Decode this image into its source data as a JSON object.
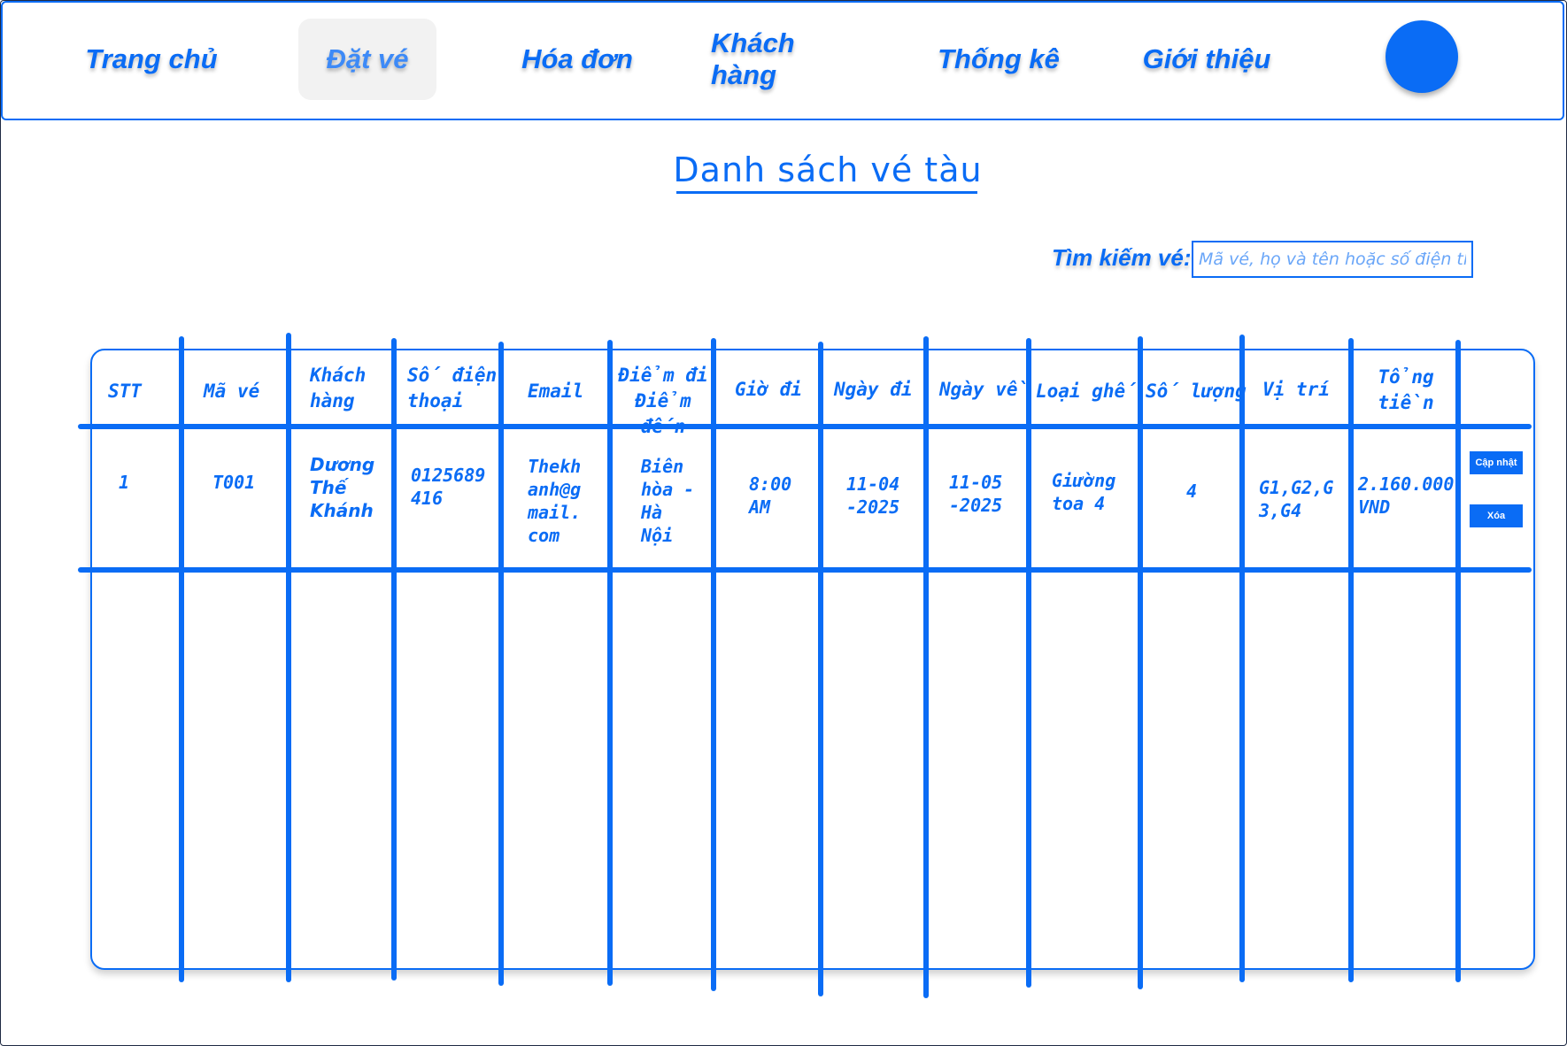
{
  "nav": {
    "items": [
      {
        "label": "Trang chủ"
      },
      {
        "label": "Đặt vé"
      },
      {
        "label": "Hóa đơn"
      },
      {
        "label": "Khách hàng"
      },
      {
        "label": "Thống kê"
      },
      {
        "label": "Giới thiệu"
      }
    ],
    "active": "Đặt vé"
  },
  "page": {
    "title": "Danh sách vé tàu"
  },
  "search": {
    "label": "Tìm kiếm vé:",
    "placeholder": "Mã vé, họ và tên hoặc số điện thoại"
  },
  "table": {
    "headers": [
      "STT",
      "Mã vé",
      "Khách hàng",
      "Số điện thoại",
      "Email",
      "Điểm đi Điểm đến",
      "Giờ đi",
      "Ngày đi",
      "Ngày về",
      "Loại ghế",
      "Số lượng",
      "Vị trí",
      "Tổng tiền"
    ],
    "rows": [
      {
        "stt": "1",
        "ma_ve": "T001",
        "khach_hang": "Dương Thế Khánh",
        "so_dien_thoai": "0125689416",
        "email": "Thekhanh@gmail.com",
        "diem_di_den": "Biên hòa - Hà Nội",
        "gio_di": "8:00 AM",
        "ngay_di": "11-04-2025",
        "ngay_ve": "11-05-2025",
        "loai_ghe": "Giường toa 4",
        "so_luong": "4",
        "vi_tri": "G1,G2,G3,G4",
        "tong_tien": "2.160.000 VND",
        "actions": {
          "update": "Cập nhật",
          "delete": "Xóa"
        }
      }
    ]
  },
  "colors": {
    "accent": "#0a6cf5",
    "active_tab_bg": "#f2f2f2"
  }
}
